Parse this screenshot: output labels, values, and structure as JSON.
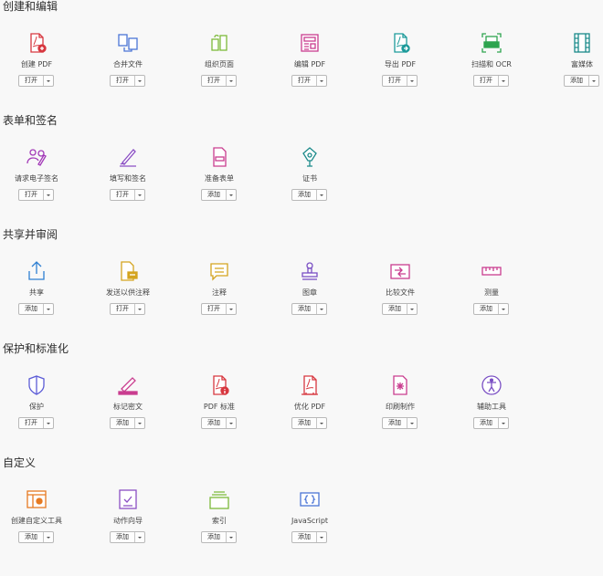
{
  "sections": [
    {
      "title": "创建和编辑",
      "tools": [
        {
          "label": "创建 PDF",
          "button": "打开",
          "icon": "create-pdf-icon",
          "color": "#d7373f"
        },
        {
          "label": "合并文件",
          "button": "打开",
          "icon": "combine-files-icon",
          "color": "#4b75d6"
        },
        {
          "label": "组织页面",
          "button": "打开",
          "icon": "organize-pages-icon",
          "color": "#7dba3a"
        },
        {
          "label": "编辑 PDF",
          "button": "打开",
          "icon": "edit-pdf-icon",
          "color": "#c93d8f"
        },
        {
          "label": "导出 PDF",
          "button": "打开",
          "icon": "export-pdf-icon",
          "color": "#1c9a9a"
        },
        {
          "label": "扫描和 OCR",
          "button": "打开",
          "icon": "scan-ocr-icon",
          "color": "#2ea44f"
        },
        {
          "label": "富媒体",
          "button": "添加",
          "icon": "rich-media-icon",
          "color": "#1a8a8a"
        }
      ]
    },
    {
      "title": "表单和签名",
      "tools": [
        {
          "label": "请求电子签名",
          "button": "打开",
          "icon": "request-esign-icon",
          "color": "#a33ab8"
        },
        {
          "label": "填写和签名",
          "button": "打开",
          "icon": "fill-sign-icon",
          "color": "#8b4fc4"
        },
        {
          "label": "准备表单",
          "button": "添加",
          "icon": "prepare-form-icon",
          "color": "#c93d8f"
        },
        {
          "label": "证书",
          "button": "添加",
          "icon": "certificate-icon",
          "color": "#1c8a8a"
        }
      ]
    },
    {
      "title": "共享并审阅",
      "tools": [
        {
          "label": "共享",
          "button": "添加",
          "icon": "share-icon",
          "color": "#2d7fd2"
        },
        {
          "label": "发送以供注释",
          "button": "打开",
          "icon": "send-comments-icon",
          "color": "#d4a41f"
        },
        {
          "label": "注释",
          "button": "打开",
          "icon": "comment-icon",
          "color": "#d4a41f"
        },
        {
          "label": "图章",
          "button": "添加",
          "icon": "stamp-icon",
          "color": "#7a4fc4"
        },
        {
          "label": "比较文件",
          "button": "添加",
          "icon": "compare-files-icon",
          "color": "#c93d8f"
        },
        {
          "label": "测量",
          "button": "添加",
          "icon": "measure-icon",
          "color": "#c93d8f"
        }
      ]
    },
    {
      "title": "保护和标准化",
      "tools": [
        {
          "label": "保护",
          "button": "打开",
          "icon": "protect-icon",
          "color": "#5c5cd6"
        },
        {
          "label": "标记密文",
          "button": "添加",
          "icon": "redact-icon",
          "color": "#c93d8f"
        },
        {
          "label": "PDF 标准",
          "button": "添加",
          "icon": "pdf-standards-icon",
          "color": "#d7373f"
        },
        {
          "label": "优化 PDF",
          "button": "添加",
          "icon": "optimize-pdf-icon",
          "color": "#d7373f"
        },
        {
          "label": "印刷制作",
          "button": "添加",
          "icon": "print-production-icon",
          "color": "#c93d8f"
        },
        {
          "label": "辅助工具",
          "button": "添加",
          "icon": "accessibility-icon",
          "color": "#7a4fc4"
        }
      ]
    },
    {
      "title": "自定义",
      "tools": [
        {
          "label": "创建自定义工具",
          "button": "添加",
          "icon": "custom-tool-icon",
          "color": "#e67a22"
        },
        {
          "label": "动作向导",
          "button": "添加",
          "icon": "action-wizard-icon",
          "color": "#8b4fc4"
        },
        {
          "label": "索引",
          "button": "添加",
          "icon": "index-icon",
          "color": "#7dba3a"
        },
        {
          "label": "JavaScript",
          "button": "添加",
          "icon": "javascript-icon",
          "color": "#4b75d6"
        }
      ]
    }
  ]
}
